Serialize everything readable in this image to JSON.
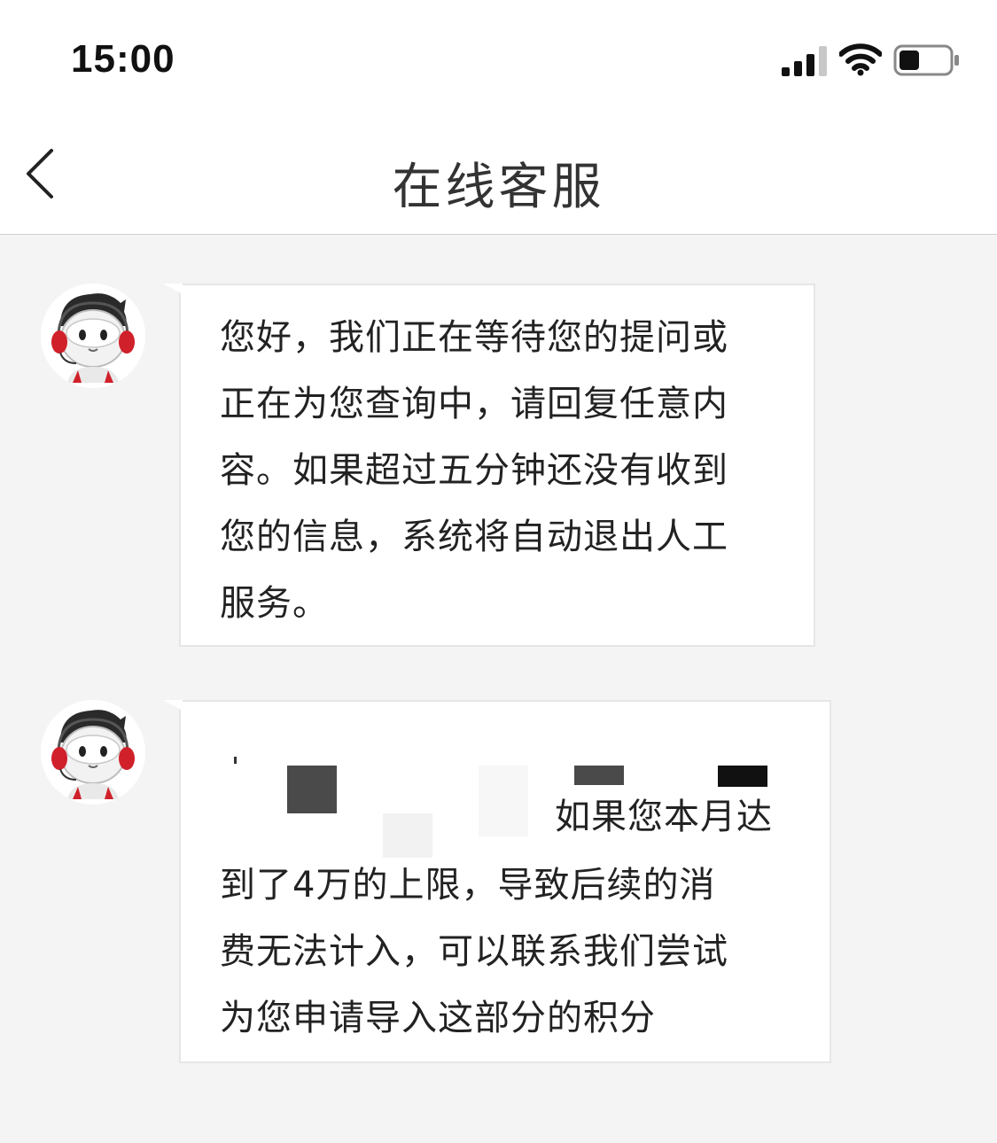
{
  "status_bar": {
    "time": "15:00",
    "signal_icon": "cellular-signal-icon",
    "wifi_icon": "wifi-icon",
    "battery_icon": "battery-icon"
  },
  "nav": {
    "back_icon": "chevron-left-icon",
    "title": "在线客服"
  },
  "messages": [
    {
      "sender": "agent",
      "avatar_icon": "customer-service-robot-avatar",
      "text": "您好，我们正在等待您的提问或\n正在为您查询中，请回复任意内\n容。如果超过五分钟还没有收到\n您的信息，系统将自动退出人工\n服务。"
    },
    {
      "sender": "agent",
      "avatar_icon": "customer-service-robot-avatar",
      "text_first_line_visible": "如果您本月达",
      "text_rest": "到了4万的上限，导致后续的消\n费无法计入，可以联系我们尝试\n为您申请导入这部分的积分"
    }
  ],
  "colors": {
    "background": "#f4f4f4",
    "bubble": "#ffffff",
    "headset_red": "#d0202a",
    "text": "#222222"
  }
}
